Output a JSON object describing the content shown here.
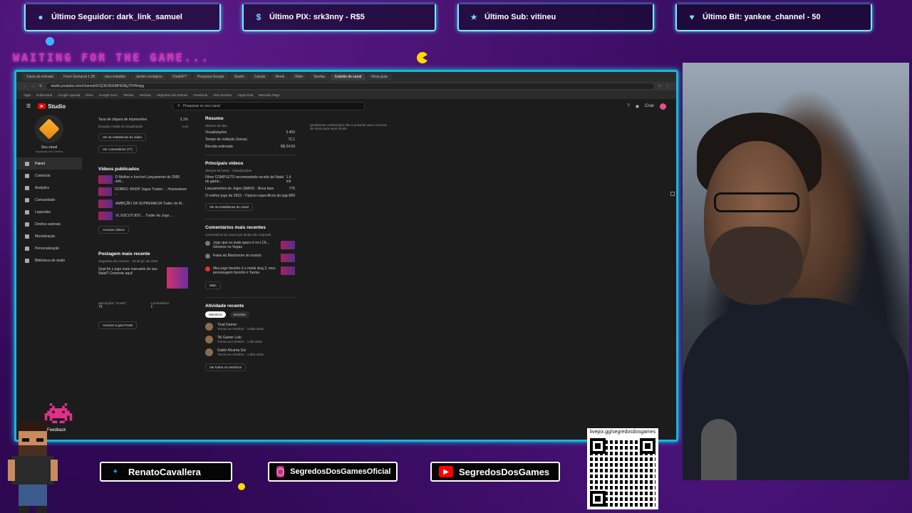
{
  "top_banners": [
    {
      "icon": "user-icon",
      "text": "Último Seguidor: dark_link_samuel"
    },
    {
      "icon": "dollar-icon",
      "text": "Último PIX: srk3nny - R$5"
    },
    {
      "icon": "star-icon",
      "text": "Último Sub: vitineu"
    },
    {
      "icon": "heart-icon",
      "text": "Último Bit: yankee_channel - 50"
    }
  ],
  "waiting_text": "WAITING FOR THE GAME...",
  "browser": {
    "tabs": [
      "Caixa de entrada",
      "Form Semanal 1.28",
      "meu trabalho",
      "Jardim zoológico",
      "ChatGPT",
      "Pesquisa Google",
      "Studio",
      "Canais",
      "Reels",
      "Obter",
      "Tarefas",
      "Estúdio do canal",
      "Nova guia"
    ],
    "address": "studio.youtube.com/channel/UCjOEOEEMHiOiEjJYHHmpg",
    "bookmarks": [
      "Apps",
      "Enfermaria",
      "Google Agenda",
      "Drive",
      "Google Docs",
      "Tarefas",
      "Notícias",
      "Segredos dos Games",
      "Facebook",
      "Alex Serrano",
      "Jogos Dixit",
      "Mercado Pago"
    ]
  },
  "studio": {
    "logo": "Studio",
    "search_placeholder": "Pesquisar no seu canal",
    "create_label": "Criar",
    "channel_name": "Seu canal",
    "channel_sub": "Segredos dos Games",
    "nav": [
      "Painel",
      "Conteúdo",
      "Analytics",
      "Comunidade",
      "Legendas",
      "Direitos autorais",
      "Monetização",
      "Personalização",
      "Biblioteca de áudio"
    ],
    "col1": {
      "metric1_label": "Taxa de cliques de impressões",
      "metric1_value": "3,1%",
      "metric2_label": "Duração média da visualização",
      "metric2_value": "1:43",
      "btn_stats": "Ver as estatísticas do vídeo",
      "btn_comments": "Ver comentários (77)",
      "published_title": "Vídeos publicados",
      "videos": [
        "O Melhor e Incrível Lançamento do 2000 refit...",
        "DOBRO: MXDP Jogue Tunker ... Humankeen ...",
        "AMBIÇÃO DA SUPREMACIA Trailer do M...",
        "VL ESCUTUDO ... Trailer do Jogo ..."
      ],
      "btn_more_videos": "Acessar vídeos",
      "post_title": "Postagem mais recente",
      "post_author": "Segredos dos Games",
      "post_date": "25 de jul. de 2023",
      "post_text": "Qual foi o jogo mais marcante do seu Natal? Comente aqui!",
      "stat1_label": "Marcações \"Gostei\"",
      "stat1_value": "73",
      "stat2_label": "Comentários",
      "stat2_value": "1",
      "btn_posts": "Acessar a guia Posts"
    },
    "col2": {
      "summary_title": "Resumo",
      "summary_sub": "Últimos 28 dias",
      "rows": [
        {
          "label": "Visualizações",
          "value": "2.453"
        },
        {
          "label": "Tempo de exibição (horas)",
          "value": "72,1"
        },
        {
          "label": "Receita estimada",
          "value": "R$ 24,59"
        }
      ],
      "top_videos_title": "Principais vídeos",
      "top_videos_sub": "Últimas 48 horas · Visualizações",
      "top_videos": [
        {
          "title": "Filme COMPLETO recomendado na tela de Natal do game...",
          "value": "1,4 mil"
        },
        {
          "title": "Lançamentos de Jogos (MAIO) - Nova fase",
          "value": "776"
        },
        {
          "title": "O melhor jogo de 2023 - Tópicos específicos do jogo",
          "value": "689"
        }
      ],
      "btn_channel_stats": "Ver as estatísticas do canal",
      "comments_title": "Comentários mais recentes",
      "comments_sub": "Comentários do canal que ainda não respondi",
      "comments": [
        "Jogo que eu mais quero é no LOL... Glorioso no Vegas",
        "Falas da Blackmore do mundo",
        "Meu jogo favorito é o metal slug 3, meu personagem favorito é Tarma"
      ],
      "btn_more_comments": "Mais",
      "activity_title": "Atividade recente",
      "chip_subs": "Membros",
      "chip_other": "Inscritos",
      "activity": [
        {
          "name": "Tioal Gamer",
          "sub": "Tornou-se membro · 3 dias atrás"
        },
        {
          "name": "Tel Gamer Loki",
          "sub": "Tornou-se membro · 1 dia atrás"
        },
        {
          "name": "Gabin Alcanta Sul",
          "sub": "Tornou-se membro · 4 dias atrás"
        }
      ],
      "btn_all_subs": "Ver todos os membros"
    },
    "col3_note": "(problemas conhecidos) não é possível usar o recurso de remix para seus shorts"
  },
  "socials": [
    {
      "icon": "twitter-icon",
      "text": "RenatoCavallera",
      "color": "#1da1f2"
    },
    {
      "icon": "instagram-icon",
      "text": "SegredosDosGamesOficial",
      "color": "#c13584"
    },
    {
      "icon": "youtube-icon",
      "text": "SegredosDosGames",
      "color": "#ff0000"
    }
  ],
  "qr_caption": "livepix.gg/segredosdosgames",
  "feedback_label": "Feedback",
  "colors": {
    "frame": "#19b5d6",
    "background": "#3a0f5e",
    "waiting": "#c23cb8"
  }
}
